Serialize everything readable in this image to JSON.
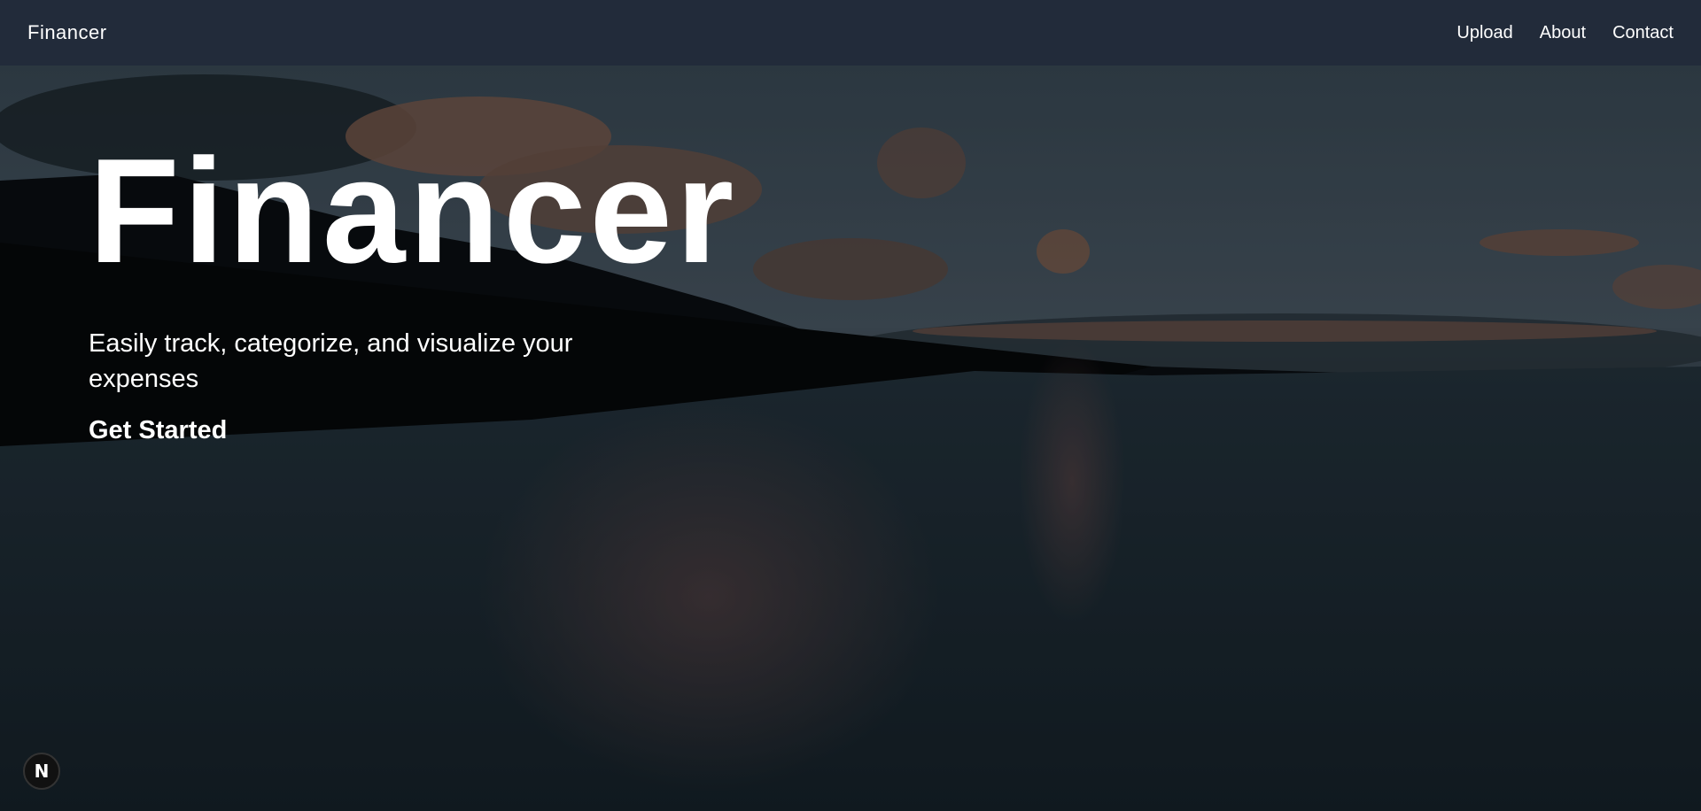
{
  "navbar": {
    "brand": "Financer",
    "links": [
      "Upload",
      "About",
      "Contact"
    ]
  },
  "hero": {
    "title": "Financer",
    "subtitle": "Easily track, categorize, and visualize your expenses",
    "cta": "Get Started",
    "background": "sunset-over-ocean-photo"
  },
  "badge": {
    "icon": "nextjs-icon",
    "letter": "N"
  },
  "colors": {
    "navbar": "#222b3a",
    "text": "#ffffff"
  }
}
